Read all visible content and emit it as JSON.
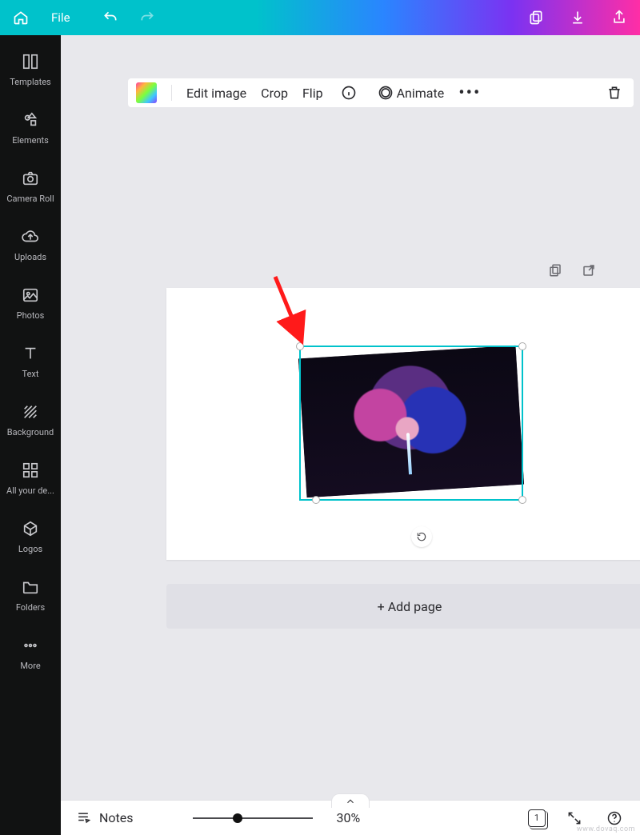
{
  "topbar": {
    "file_label": "File"
  },
  "sidebar": {
    "items": [
      {
        "label": "Templates"
      },
      {
        "label": "Elements"
      },
      {
        "label": "Camera Roll"
      },
      {
        "label": "Uploads"
      },
      {
        "label": "Photos"
      },
      {
        "label": "Text"
      },
      {
        "label": "Background"
      },
      {
        "label": "All your de..."
      },
      {
        "label": "Logos"
      },
      {
        "label": "Folders"
      },
      {
        "label": "More"
      }
    ]
  },
  "ctxbar": {
    "edit_image": "Edit image",
    "crop": "Crop",
    "flip": "Flip",
    "animate": "Animate"
  },
  "canvas": {
    "add_page": "+ Add page"
  },
  "bottombar": {
    "notes": "Notes",
    "zoom": "30%",
    "page_count": "1"
  },
  "watermark": "www.dovaq.com"
}
